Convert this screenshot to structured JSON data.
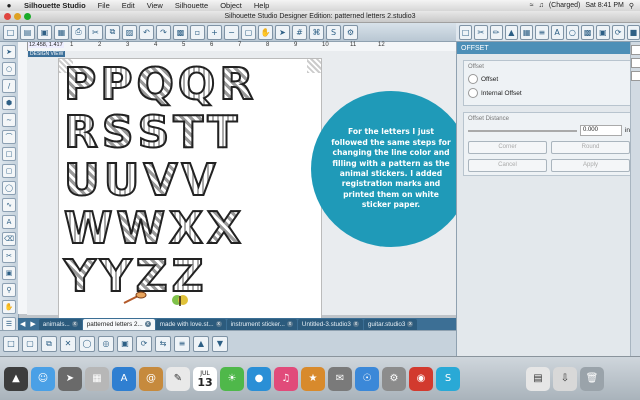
{
  "menubar": {
    "apple": "",
    "items": [
      "Silhouette Studio",
      "File",
      "Edit",
      "View",
      "Silhouette",
      "Object",
      "Help"
    ],
    "battery": "(Charged)",
    "clock": "Sat 8:41 PM"
  },
  "window": {
    "title": "Silhouette Studio Designer Edition: patterned letters 2.studio3"
  },
  "ruler": {
    "coords": "12.458, 1.417",
    "ticks": [
      "1",
      "2",
      "3",
      "4",
      "5",
      "6",
      "7",
      "8",
      "9",
      "10",
      "11",
      "12"
    ]
  },
  "canvas": {
    "design_view": "DESIGN VIEW",
    "rows": [
      [
        "P",
        "P",
        "Q",
        "Q",
        "R"
      ],
      [
        "R",
        "S",
        "S",
        "T",
        "T"
      ],
      [
        "U",
        "U",
        "V",
        "V"
      ],
      [
        "W",
        "W",
        "X",
        "X"
      ],
      [
        "Y",
        "Y",
        "Z",
        "Z"
      ]
    ],
    "note": "For the letters I just followed the same steps for changing the line color and filling with a pattern as the animal stickers.  I added registration marks and printed them on white sticker paper."
  },
  "tabs": [
    {
      "label": "animals...",
      "active": false
    },
    {
      "label": "patterned letters 2...",
      "active": true
    },
    {
      "label": "made with love.st...",
      "active": false
    },
    {
      "label": "instrument sticker...",
      "active": false
    },
    {
      "label": "Untitled-3.studio3",
      "active": false
    },
    {
      "label": "guitar.studio3",
      "active": false
    }
  ],
  "panel": {
    "title": "OFFSET",
    "offset_label": "Offset",
    "option_offset": "Offset",
    "option_internal": "Internal Offset",
    "distance_label": "Offset Distance",
    "distance_value": "0.000",
    "unit": "in",
    "corner_label": "Corner",
    "round_label": "Round",
    "cancel": "Cancel",
    "apply": "Apply"
  },
  "dock": {
    "calendar_month": "JUL",
    "calendar_day": "13"
  },
  "colors": {
    "bubble": "#1f9ab8",
    "panel_header": "#4d8fb7",
    "tab_bar": "#3c6f95"
  }
}
